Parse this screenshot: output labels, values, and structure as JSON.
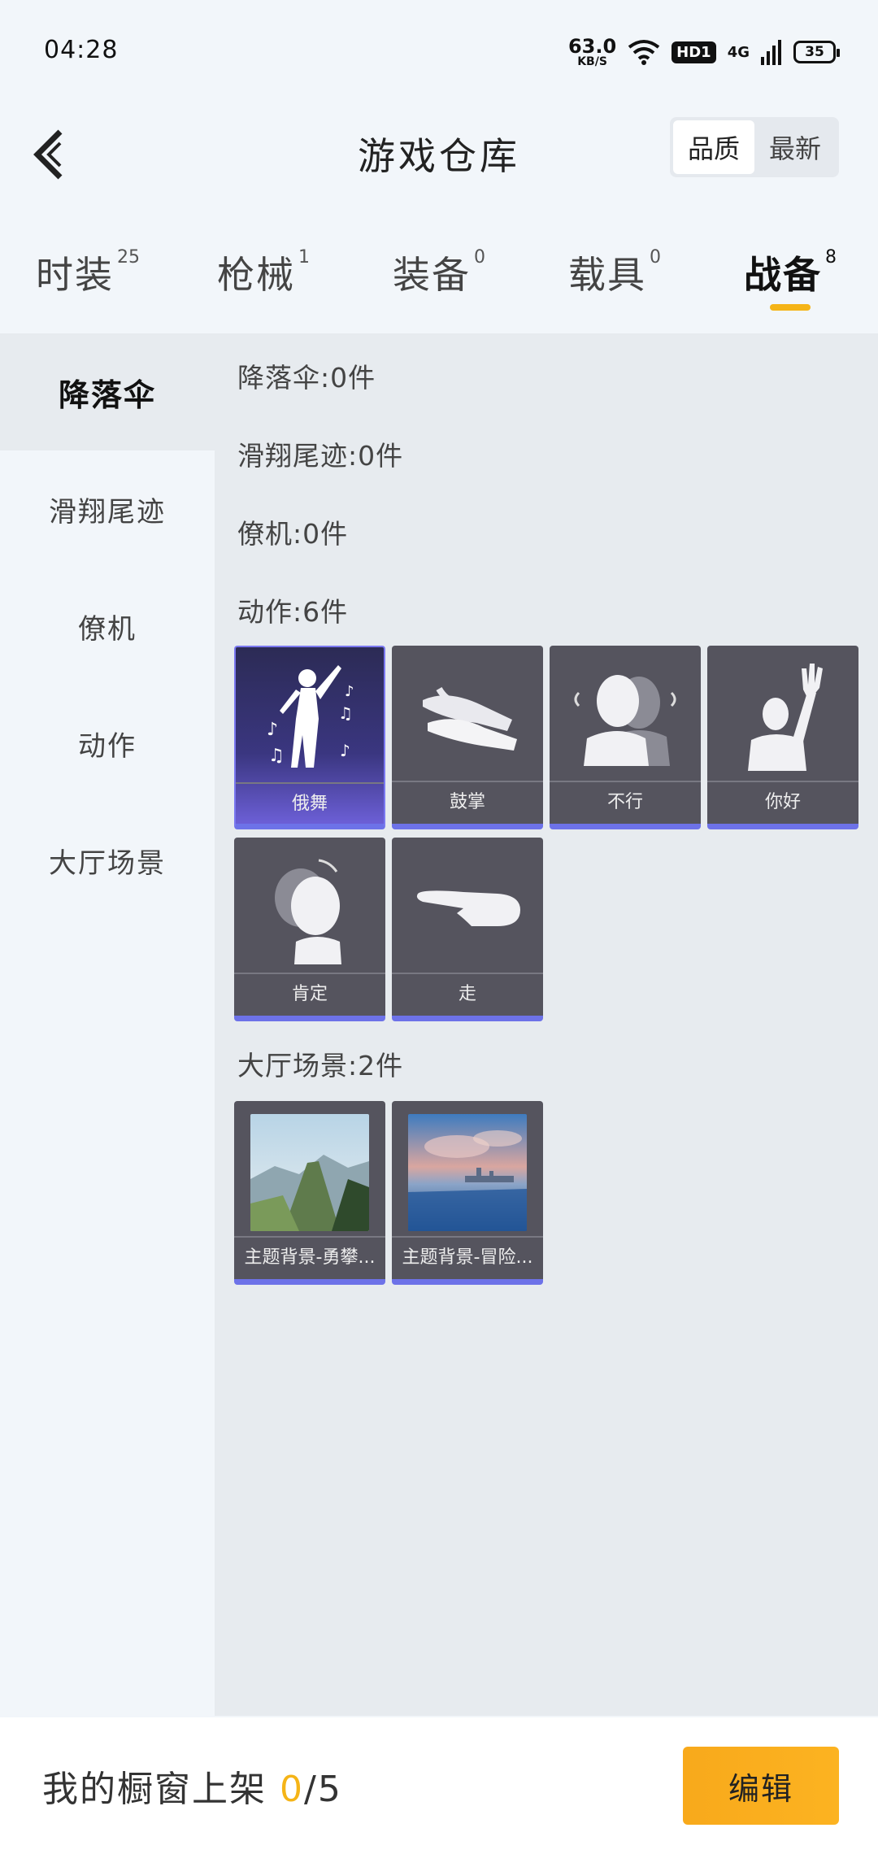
{
  "status": {
    "time": "04:28",
    "net_speed_value": "63.0",
    "net_speed_unit": "KB/S",
    "hd_label": "HD1",
    "network_label": "4G",
    "battery": "35"
  },
  "header": {
    "title": "游戏仓库",
    "sort_options": [
      "品质",
      "最新"
    ],
    "active_sort": "品质"
  },
  "tabs": [
    {
      "label": "时装",
      "count": "25"
    },
    {
      "label": "枪械",
      "count": "1"
    },
    {
      "label": "装备",
      "count": "0"
    },
    {
      "label": "载具",
      "count": "0"
    },
    {
      "label": "战备",
      "count": "8"
    }
  ],
  "active_tab": "战备",
  "sidebar": {
    "items": [
      "降落伞",
      "滑翔尾迹",
      "僚机",
      "动作",
      "大厅场景"
    ],
    "active": "降落伞"
  },
  "sections": [
    {
      "title": "降落伞:0件"
    },
    {
      "title": "滑翔尾迹:0件"
    },
    {
      "title": "僚机:0件"
    },
    {
      "title": "动作:6件",
      "items": [
        {
          "label": "俄舞",
          "icon": "dancer-icon"
        },
        {
          "label": "鼓掌",
          "icon": "clapping-hands-icon"
        },
        {
          "label": "不行",
          "icon": "head-shake-icon"
        },
        {
          "label": "你好",
          "icon": "waving-person-icon"
        },
        {
          "label": "肯定",
          "icon": "head-nod-icon"
        },
        {
          "label": "走",
          "icon": "pointing-hand-icon"
        }
      ]
    },
    {
      "title": "大厅场景:2件",
      "items": [
        {
          "label": "主题背景-勇攀...",
          "icon": "mountain-scene-thumb"
        },
        {
          "label": "主题背景-冒险...",
          "icon": "sea-city-scene-thumb"
        }
      ]
    }
  ],
  "bottom": {
    "label": "我的橱窗上架",
    "count_current": "0",
    "count_sep_total": "/5",
    "edit_label": "编辑"
  },
  "colors": {
    "accent": "#f5b417",
    "card_bg": "#55545e",
    "card_border": "#6d72e8",
    "edit_button": "#fcb321"
  }
}
